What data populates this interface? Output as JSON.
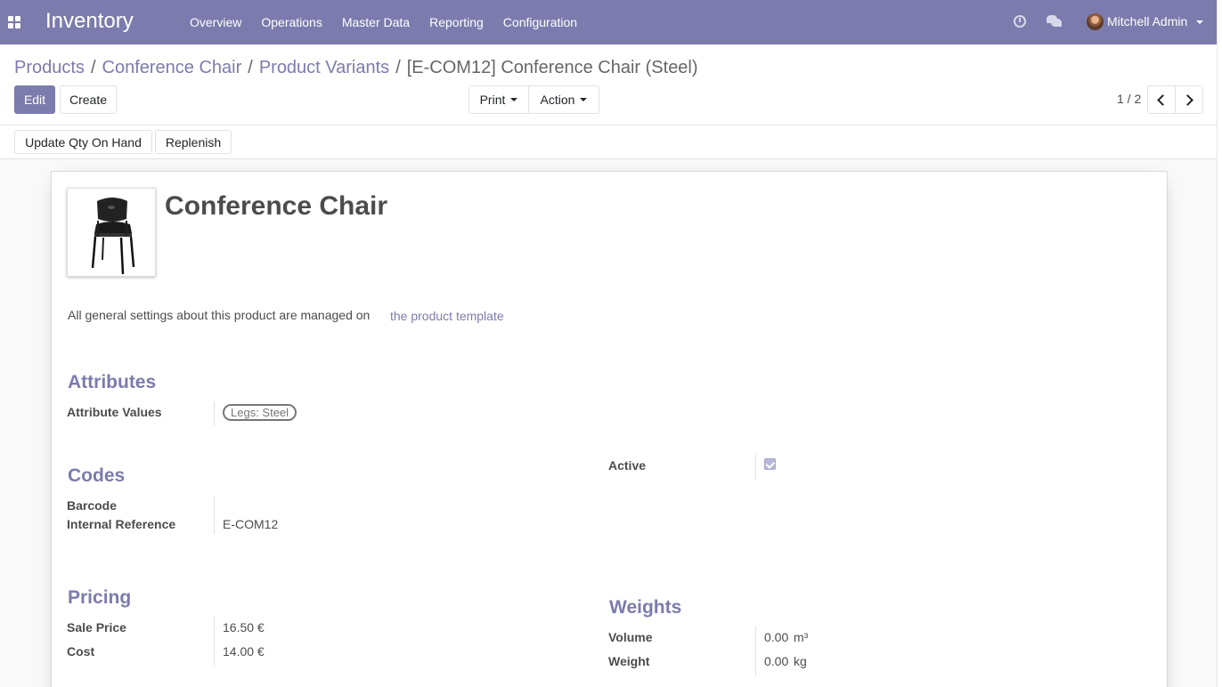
{
  "navbar": {
    "app_name": "Inventory",
    "menu": [
      "Overview",
      "Operations",
      "Master Data",
      "Reporting",
      "Configuration"
    ],
    "user": "Mitchell Admin"
  },
  "breadcrumb": {
    "items": [
      "Products",
      "Conference Chair",
      "Product Variants"
    ],
    "separator": "/",
    "current": "[E-COM12] Conference Chair (Steel)"
  },
  "toolbar": {
    "edit": "Edit",
    "create": "Create",
    "print": "Print",
    "action": "Action",
    "pager": "1 / 2"
  },
  "statusbar": {
    "update_qty": "Update Qty On Hand",
    "replenish": "Replenish"
  },
  "form": {
    "title": "Conference Chair",
    "info_text": "All general settings about this product are managed on",
    "template_link": "the product template",
    "attributes": {
      "title": "Attributes",
      "label": "Attribute Values",
      "tag": "Legs: Steel"
    },
    "codes": {
      "title": "Codes",
      "barcode_label": "Barcode",
      "barcode_value": "",
      "ref_label": "Internal Reference",
      "ref_value": "E-COM12"
    },
    "active": {
      "label": "Active",
      "checked": true
    },
    "pricing": {
      "title": "Pricing",
      "sale_label": "Sale Price",
      "sale_value": "16.50 €",
      "cost_label": "Cost",
      "cost_value": "14.00 €"
    },
    "weights": {
      "title": "Weights",
      "volume_label": "Volume",
      "volume_value": "0.00",
      "volume_unit": "m³",
      "weight_label": "Weight",
      "weight_value": "0.00",
      "weight_unit": "kg"
    }
  },
  "colors": {
    "brand": "#7c7bad",
    "text": "#4c4c4c"
  }
}
